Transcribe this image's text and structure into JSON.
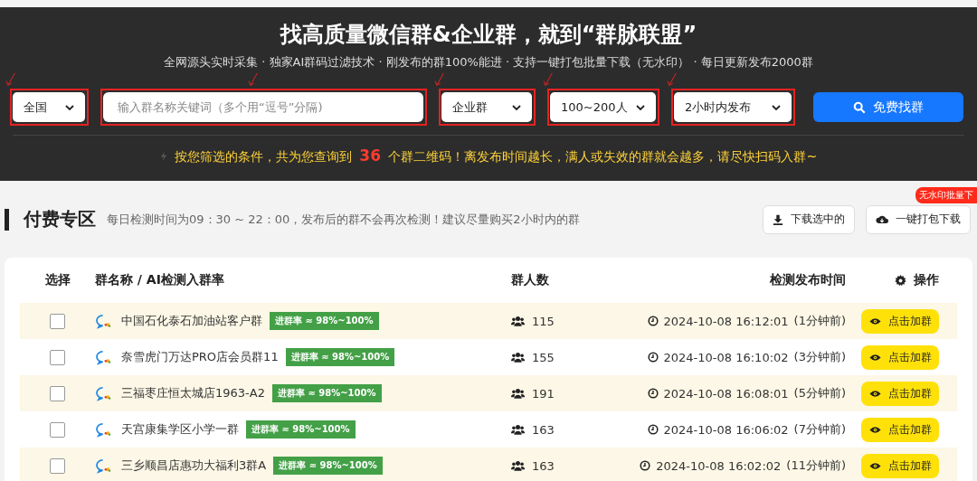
{
  "header": {
    "title": "找高质量微信群&企业群，就到“群脉联盟”",
    "subtitle": "全网源头实时采集 · 独家AI群码过滤技术 · 刚发布的群100%能进 · 支持一键打包批量下载（无水印） · 每日更新发布2000群"
  },
  "filters": [
    {
      "kind": "select",
      "value": "全国",
      "highlighted": true
    },
    {
      "kind": "input",
      "placeholder": "输入群名称关键词（多个用“逗号”分隔)",
      "highlighted": true
    },
    {
      "kind": "select",
      "value": "企业群",
      "highlighted": true
    },
    {
      "kind": "select",
      "value": "100~200人",
      "highlighted": true
    },
    {
      "kind": "select",
      "value": "2小时内发布",
      "highlighted": true
    }
  ],
  "search_button": "免费找群",
  "result": {
    "before": "按您筛选的条件，共为您查询到",
    "count": "36",
    "after": "个群二维码！离发布时间越长，满人或失效的群就会越多，请尽快扫码入群~"
  },
  "section": {
    "title": "付费专区",
    "note": "每日检测时间为09：30 ~ 22：00，发布后的群不会再次检测！建议尽量购买2小时内的群",
    "buttons": [
      {
        "label": "下载选中的",
        "kind": "download"
      },
      {
        "label": "一键打包下载",
        "kind": "cloud",
        "badge": "无水印批量下"
      }
    ]
  },
  "table": {
    "columns": [
      "选择",
      "群名称 / AI检测入群率",
      "群人数",
      "检测发布时间",
      "操作"
    ],
    "rows": [
      {
        "checked": false,
        "name": "中国石化泰石加油站客户群",
        "rate": "进群率 ≈ 98%~100%",
        "members": "115",
        "time": "2024-10-08 16:12:01",
        "ago": "(1分钟前)",
        "action": "点击加群"
      },
      {
        "checked": false,
        "name": "奈雪虎门万达PRO店会员群11",
        "rate": "进群率 ≈ 98%~100%",
        "members": "155",
        "time": "2024-10-08 16:10:02",
        "ago": "(3分钟前)",
        "action": "点击加群"
      },
      {
        "checked": false,
        "name": "三福枣庄恒太城店1963-A2",
        "rate": "进群率 ≈ 98%~100%",
        "members": "191",
        "time": "2024-10-08 16:08:01",
        "ago": "(5分钟前)",
        "action": "点击加群"
      },
      {
        "checked": false,
        "name": "天宫康集学区小学一群",
        "rate": "进群率 ≈ 98%~100%",
        "members": "163",
        "time": "2024-10-08 16:06:02",
        "ago": "(7分钟前)",
        "action": "点击加群"
      },
      {
        "checked": false,
        "name": "三乡顺昌店惠功大福利3群A",
        "rate": "进群率 ≈ 98%~100%",
        "members": "163",
        "time": "2024-10-08 16:02:02",
        "ago": "(11分钟前)",
        "action": "点击加群"
      }
    ]
  }
}
